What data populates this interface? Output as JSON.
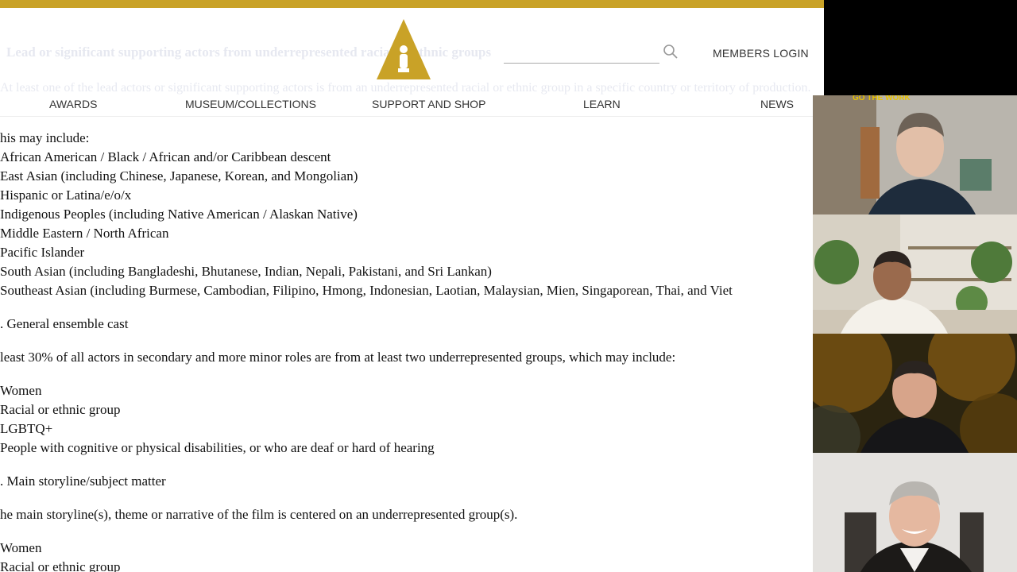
{
  "site": {
    "header_bar_color": "#c9a227",
    "faded_heading": "Lead or significant supporting actors from underrepresented racial or ethnic groups",
    "faded_paragraph": "At least one of the lead actors or significant supporting actors is from an underrepresented racial or ethnic group in a specific country or territory of production.",
    "members_login": "MEMBERS LOGIN",
    "search_icon": "search-icon",
    "nav": [
      {
        "label": "AWARDS"
      },
      {
        "label": "MUSEUM/COLLECTIONS"
      },
      {
        "label": "SUPPORT AND SHOP"
      },
      {
        "label": "LEARN"
      },
      {
        "label": "NEWS"
      }
    ]
  },
  "content": {
    "intro": "his may include:",
    "groups": [
      "African American / Black / African and/or Caribbean descent",
      "East Asian (including Chinese, Japanese, Korean, and Mongolian)",
      "Hispanic or Latina/e/o/x",
      "Indigenous Peoples (including Native American / Alaskan Native)",
      "Middle Eastern / North African",
      "Pacific Islander",
      "South Asian (including Bangladeshi, Bhutanese, Indian, Nepali, Pakistani, and Sri Lankan)",
      "Southeast Asian (including Burmese, Cambodian, Filipino, Hmong, Indonesian, Laotian, Malaysian, Mien, Singaporean, Thai, and Viet"
    ],
    "section_b_title": ". General ensemble cast",
    "section_b_text": " least 30% of all actors in secondary and more minor roles are from at least two underrepresented groups, which may include:",
    "section_b_items": [
      "Women",
      "Racial or ethnic group",
      "LGBTQ+",
      "People with cognitive or physical disabilities, or who are deaf or hard of hearing"
    ],
    "section_c_title": ". Main storyline/subject matter",
    "section_c_text": "he main storyline(s), theme or narrative of the film is centered on an underrepresented group(s).",
    "section_c_items": [
      "Women",
      "Racial or ethnic group"
    ]
  },
  "video_call": {
    "participant_1_caption": "GO THE WORK"
  }
}
